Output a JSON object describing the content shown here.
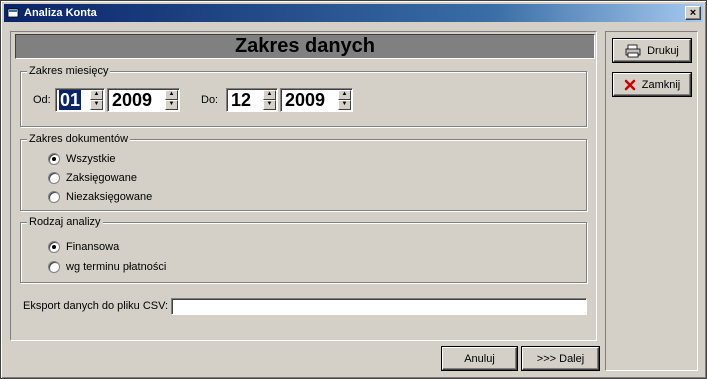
{
  "window": {
    "title": "Analiza Konta",
    "close_label": "×"
  },
  "header": {
    "title": "Zakres danych"
  },
  "months": {
    "group_label": "Zakres miesięcy",
    "from_label": "Od:",
    "from_month": "01",
    "from_year": "2009",
    "to_label": "Do:",
    "to_month": "12",
    "to_year": "2009",
    "spin_up": "▲",
    "spin_down": "▼"
  },
  "documents": {
    "group_label": "Zakres dokumentów",
    "options": [
      "Wszystkie",
      "Zaksięgowane",
      "Niezaksięgowane"
    ],
    "selected": 0
  },
  "analysis": {
    "group_label": "Rodzaj analizy",
    "options": [
      "Finansowa",
      "wg terminu płatności"
    ],
    "selected": 0
  },
  "export": {
    "label": "Eksport danych do pliku CSV:",
    "value": ""
  },
  "buttons": {
    "print": "Drukuj",
    "close": "Zamknij",
    "cancel": "Anuluj",
    "next": ">>> Dalej"
  },
  "colors": {
    "title_bar": "#0a246a",
    "header_band": "#808080",
    "close_icon": "#cc0000"
  }
}
